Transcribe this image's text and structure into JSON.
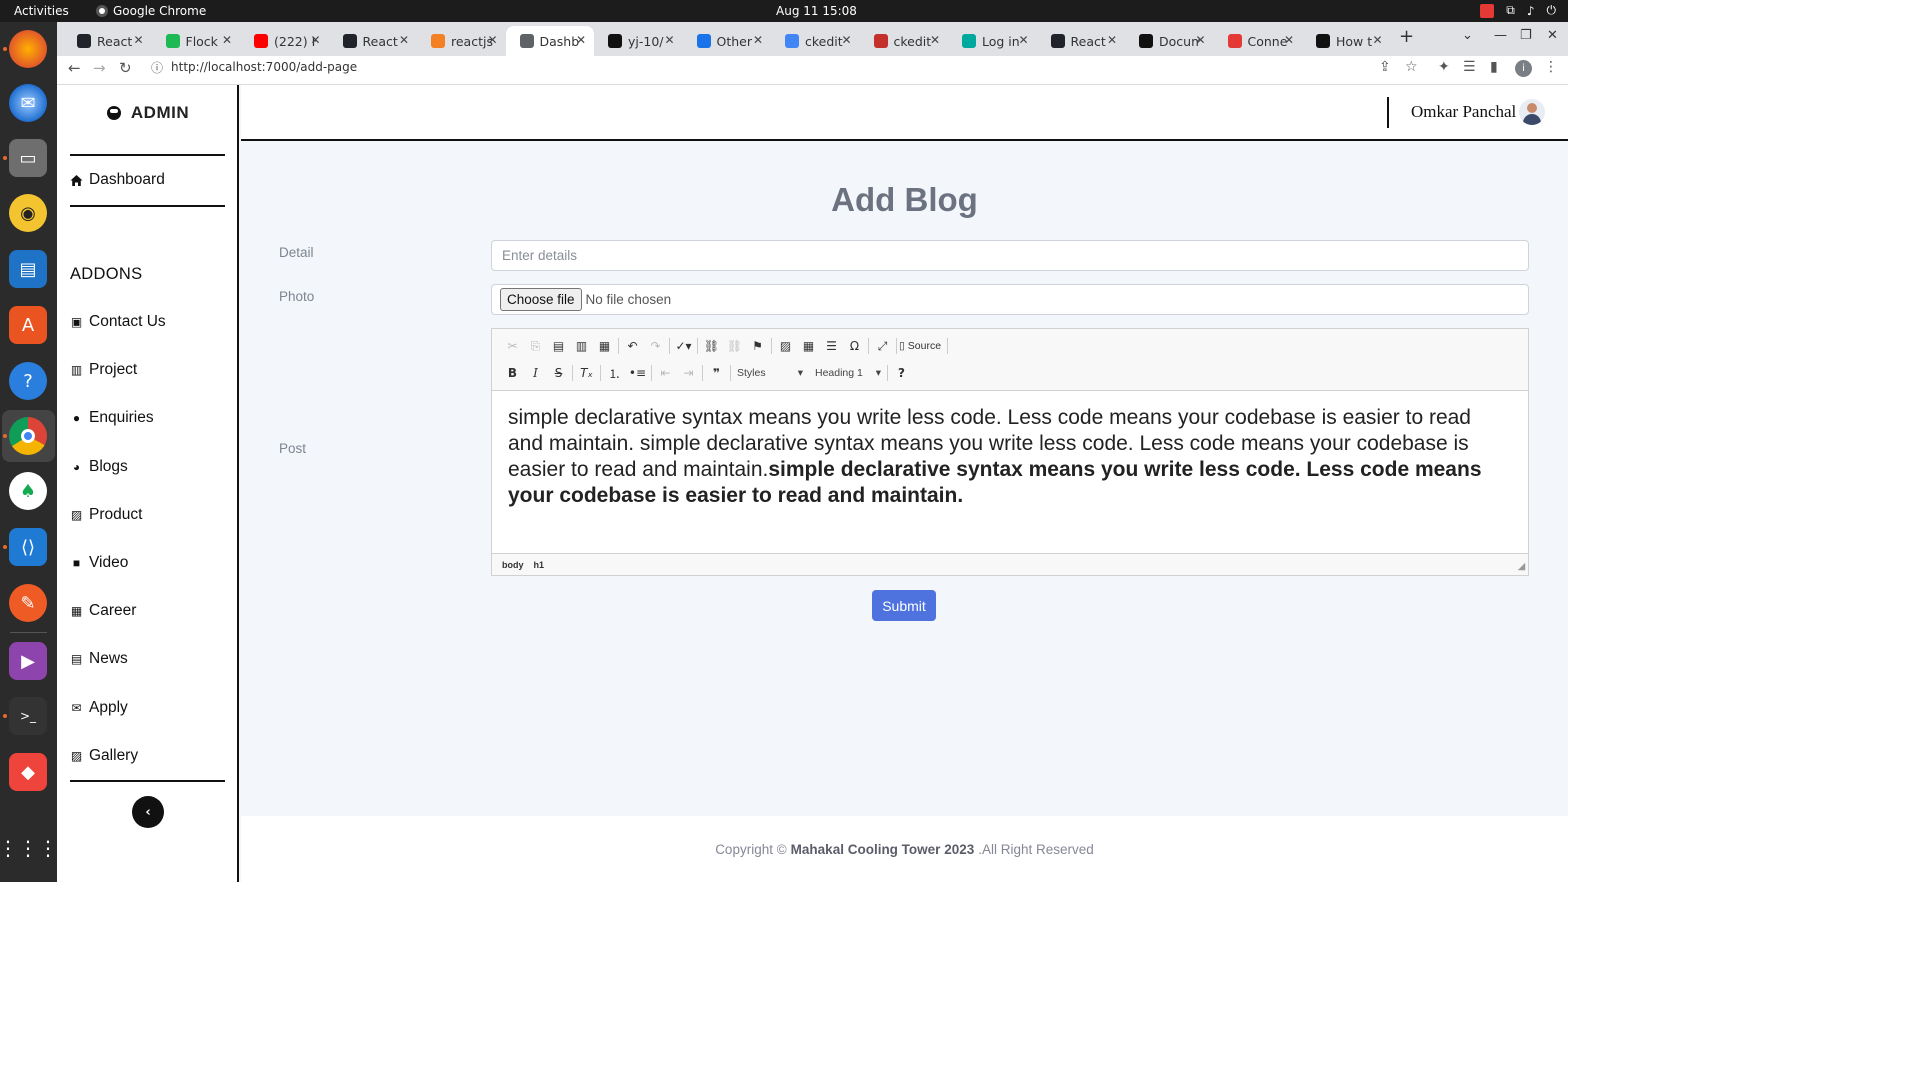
{
  "os": {
    "activities": "Activities",
    "app_name": "Google Chrome",
    "clock": "Aug 11  15:08"
  },
  "browser": {
    "tabs": [
      {
        "label": "React",
        "icon_color": "#20232a"
      },
      {
        "label": "Flock",
        "icon_color": "#1db954"
      },
      {
        "label": "(222) H",
        "icon_color": "#ff0000"
      },
      {
        "label": "React",
        "icon_color": "#20232a"
      },
      {
        "label": "reactjs",
        "icon_color": "#f48024"
      },
      {
        "label": "Dashb",
        "icon_color": "#5f6368"
      },
      {
        "label": "yj-10/",
        "icon_color": "#111111"
      },
      {
        "label": "Other",
        "icon_color": "#1a73e8"
      },
      {
        "label": "ckedit",
        "icon_color": "#4285f4"
      },
      {
        "label": "ckedit",
        "icon_color": "#c4302b"
      },
      {
        "label": "Log in",
        "icon_color": "#00a99d"
      },
      {
        "label": "React",
        "icon_color": "#20232a"
      },
      {
        "label": "Docum",
        "icon_color": "#111111"
      },
      {
        "label": "Conne",
        "icon_color": "#e53935"
      },
      {
        "label": "How t",
        "icon_color": "#111111"
      }
    ],
    "active_tab_index": 5,
    "url": "http://localhost:7000/add-page"
  },
  "app": {
    "brand": "ADMIN",
    "nav_main": {
      "label": "Dashboard",
      "icon": "home-icon"
    },
    "section_title": "ADDONS",
    "nav_items": [
      {
        "label": "Contact Us",
        "icon": "contact-card-icon",
        "glyph": "▣"
      },
      {
        "label": "Project",
        "icon": "building-icon",
        "glyph": "▥"
      },
      {
        "label": "Enquiries",
        "icon": "comment-icon",
        "glyph": "●"
      },
      {
        "label": "Blogs",
        "icon": "blog-icon",
        "glyph": "◕"
      },
      {
        "label": "Product",
        "icon": "image-icon",
        "glyph": "▨"
      },
      {
        "label": "Video",
        "icon": "video-icon",
        "glyph": "■"
      },
      {
        "label": "Career",
        "icon": "keyboard-icon",
        "glyph": "▦"
      },
      {
        "label": "News",
        "icon": "newspaper-icon",
        "glyph": "▤"
      },
      {
        "label": "Apply",
        "icon": "envelope-icon",
        "glyph": "✉"
      },
      {
        "label": "Gallery",
        "icon": "image-icon",
        "glyph": "▨"
      }
    ],
    "user_name": "Omkar Panchal"
  },
  "form": {
    "title": "Add Blog",
    "detail_label": "Detail",
    "detail_placeholder": "Enter details",
    "photo_label": "Photo",
    "file_button": "Choose file",
    "file_status": "No file chosen",
    "post_label": "Post",
    "editor": {
      "styles_label": "Styles",
      "format_label": "Heading 1",
      "source_label": "Source",
      "content_normal": " simple declarative syntax means you write less code. Less code means your codebase is easier to read and maintain. simple declarative syntax means you write less code. Less code means your codebase is easier to read and maintain.",
      "content_bold": "simple declarative syntax means you write less code. Less code means your codebase is easier to read and maintain.",
      "path": [
        "body",
        "h1"
      ]
    },
    "submit_label": "Submit"
  },
  "footer": {
    "prefix": "Copyright ©",
    "company": "Mahakal Cooling Tower 2023",
    "suffix": ".All Right Reserved"
  },
  "colors": {
    "primary": "#4e73df",
    "page_bg": "#f3f6fa"
  }
}
